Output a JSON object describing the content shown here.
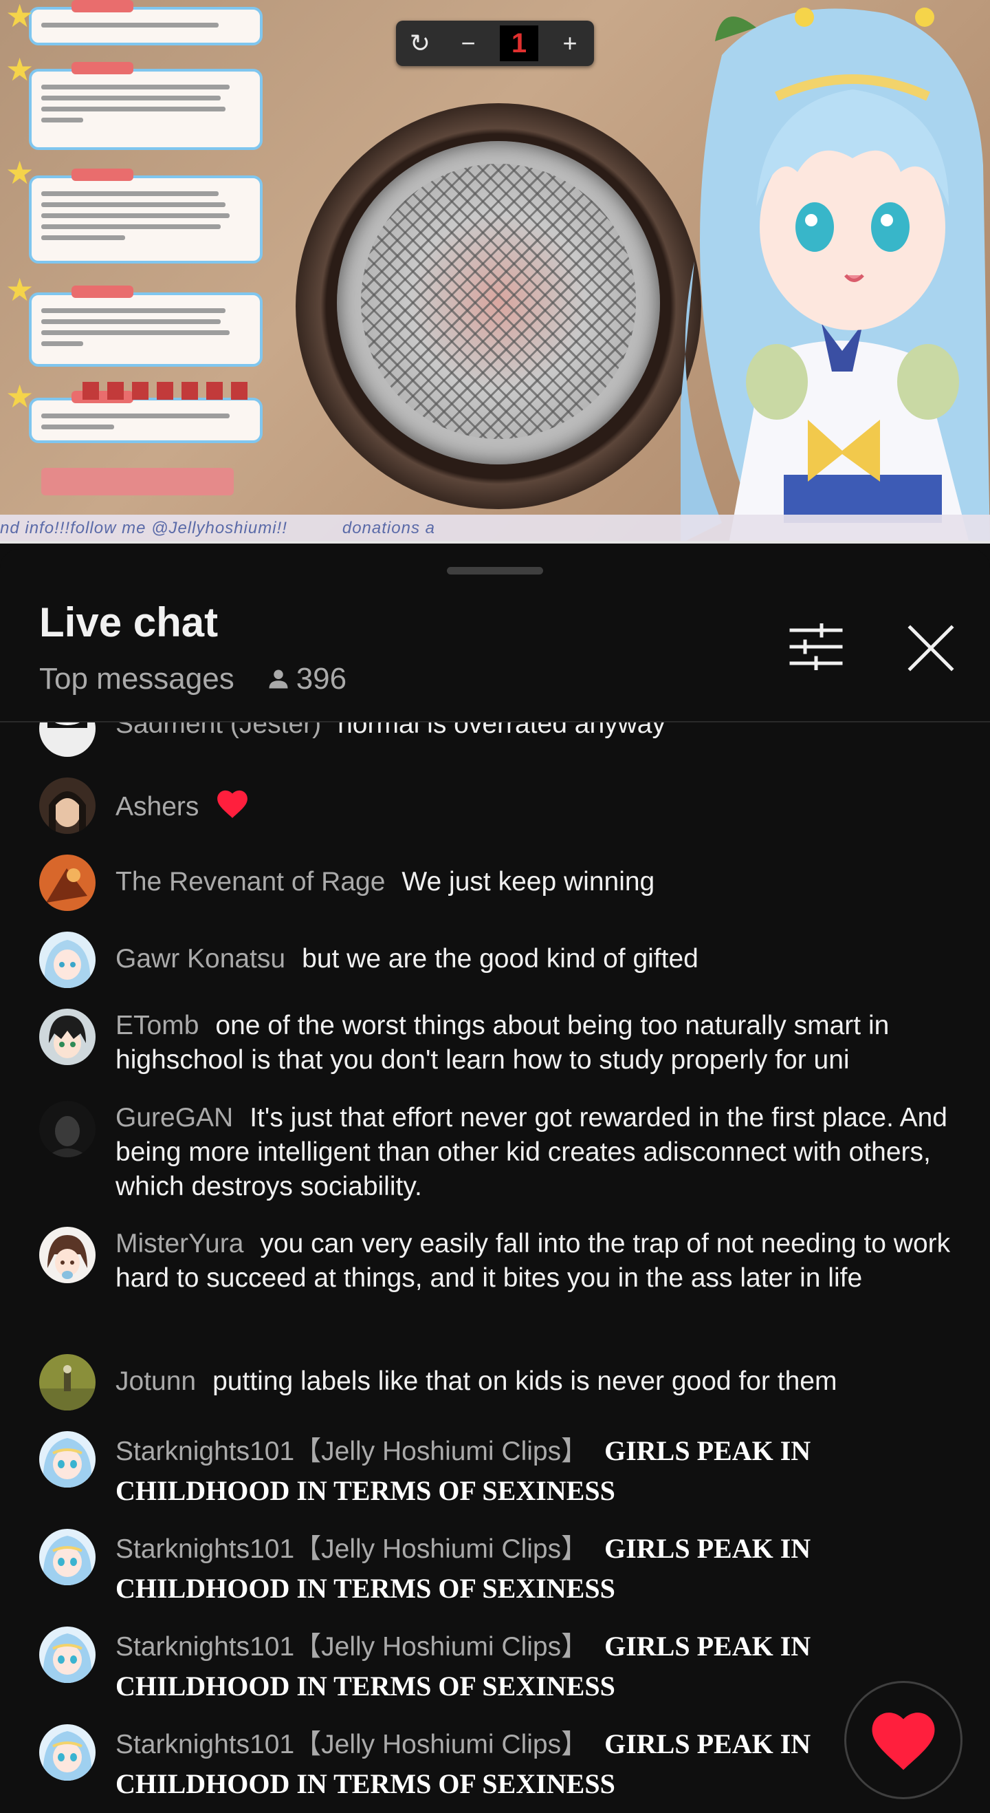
{
  "video": {
    "counter": {
      "minus": "−",
      "value": "1",
      "plus": "+"
    },
    "ticker": {
      "follow_text": "nd info!!!follow me @Jellyhoshiumi!!",
      "donations_text": "donations a"
    }
  },
  "chat": {
    "title": "Live chat",
    "mode": "Top messages",
    "viewer_count": "396",
    "messages": [
      {
        "author": "Sadment (Jester)",
        "text": "normal is overrated anyway",
        "avatar": "white-mask"
      },
      {
        "author": "Ashers",
        "text": "",
        "emoji": "heart",
        "avatar": "dark-hair-girl"
      },
      {
        "author": "The Revenant of Rage",
        "text": "We just keep winning",
        "avatar": "orange-robot"
      },
      {
        "author": "Gawr Konatsu",
        "text": "but we are the good kind of gifted",
        "avatar": "blue-hair-girl"
      },
      {
        "author": "ETomb",
        "text": "one of the worst things about being too naturally smart in highschool is that you don't learn how to study properly for uni",
        "avatar": "anime-boy"
      },
      {
        "author": "GureGAN",
        "text": "It's just that effort never got rewarded in the first place. And being more intelligent than other kid creates adisconnect with others, which destroys sociability.",
        "avatar": "dark-figure"
      },
      {
        "author": "MisterYura",
        "text": "you can very easily fall into the trap of not needing to work hard to succeed at things, and it bites you in the ass later in life",
        "avatar": "brown-hair-girl"
      },
      {
        "author": "Jotunn",
        "text": "putting labels like that on kids is never good for them",
        "avatar": "green-field"
      },
      {
        "author": "Starknights101【Jelly Hoshiumi Clips】",
        "text": "GIRLS PEAK IN CHILDHOOD IN TERMS OF SEXINESS",
        "avatar": "jelly-avatar"
      },
      {
        "author": "Starknights101【Jelly Hoshiumi Clips】",
        "text": "GIRLS PEAK IN CHILDHOOD IN TERMS OF SEXINESS",
        "avatar": "jelly-avatar"
      },
      {
        "author": "Starknights101【Jelly Hoshiumi Clips】",
        "text": "GIRLS PEAK IN CHILDHOOD IN TERMS OF SEXINESS",
        "avatar": "jelly-avatar"
      },
      {
        "author": "Starknights101【Jelly Hoshiumi Clips】",
        "text": "GIRLS PEAK IN CHILDHOOD IN TERMS OF SEXINESS",
        "avatar": "jelly-avatar"
      }
    ]
  },
  "icons": {
    "filter": "sliders-icon",
    "close": "close-icon",
    "viewers": "person-icon",
    "reaction": "heart-icon"
  },
  "colors": {
    "background": "#0f0f0f",
    "author": "#aaaaaa",
    "text": "#f1f1f1",
    "heart": "#ff0033"
  }
}
